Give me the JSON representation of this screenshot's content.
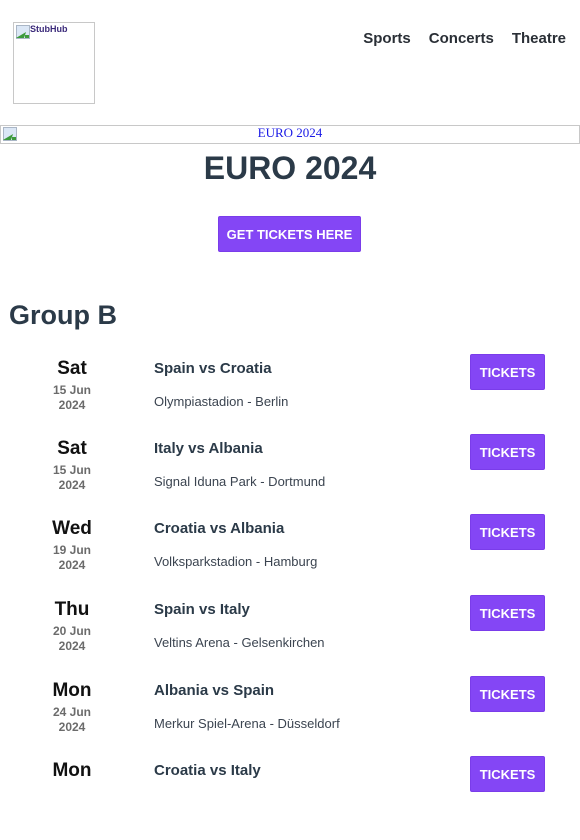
{
  "header": {
    "logo_alt": "StubHub",
    "nav": [
      {
        "label": "Sports"
      },
      {
        "label": "Concerts"
      },
      {
        "label": "Theatre"
      }
    ]
  },
  "banner": {
    "alt": "EURO 2024"
  },
  "hero": {
    "title": "EURO 2024",
    "cta_label": "GET TICKETS HERE"
  },
  "colors": {
    "accent": "#8446f5",
    "heading": "#2b3a48"
  },
  "group": {
    "title": "Group B",
    "matches": [
      {
        "day": "Sat",
        "date": "15 Jun",
        "year": "2024",
        "teams": "Spain vs Croatia",
        "venue": "Olympiastadion - Berlin",
        "button": "TICKETS"
      },
      {
        "day": "Sat",
        "date": "15 Jun",
        "year": "2024",
        "teams": "Italy vs Albania",
        "venue": "Signal Iduna Park - Dortmund",
        "button": "TICKETS"
      },
      {
        "day": "Wed",
        "date": "19 Jun",
        "year": "2024",
        "teams": "Croatia vs Albania",
        "venue": "Volksparkstadion - Hamburg",
        "button": "TICKETS"
      },
      {
        "day": "Thu",
        "date": "20 Jun",
        "year": "2024",
        "teams": "Spain vs Italy",
        "venue": "Veltins Arena - Gelsenkirchen",
        "button": "TICKETS"
      },
      {
        "day": "Mon",
        "date": "24 Jun",
        "year": "2024",
        "teams": "Albania vs Spain",
        "venue": "Merkur Spiel-Arena - Düsseldorf",
        "button": "TICKETS"
      },
      {
        "day": "Mon",
        "date": "",
        "year": "",
        "teams": "Croatia vs Italy",
        "venue": "",
        "button": "TICKETS"
      }
    ]
  }
}
